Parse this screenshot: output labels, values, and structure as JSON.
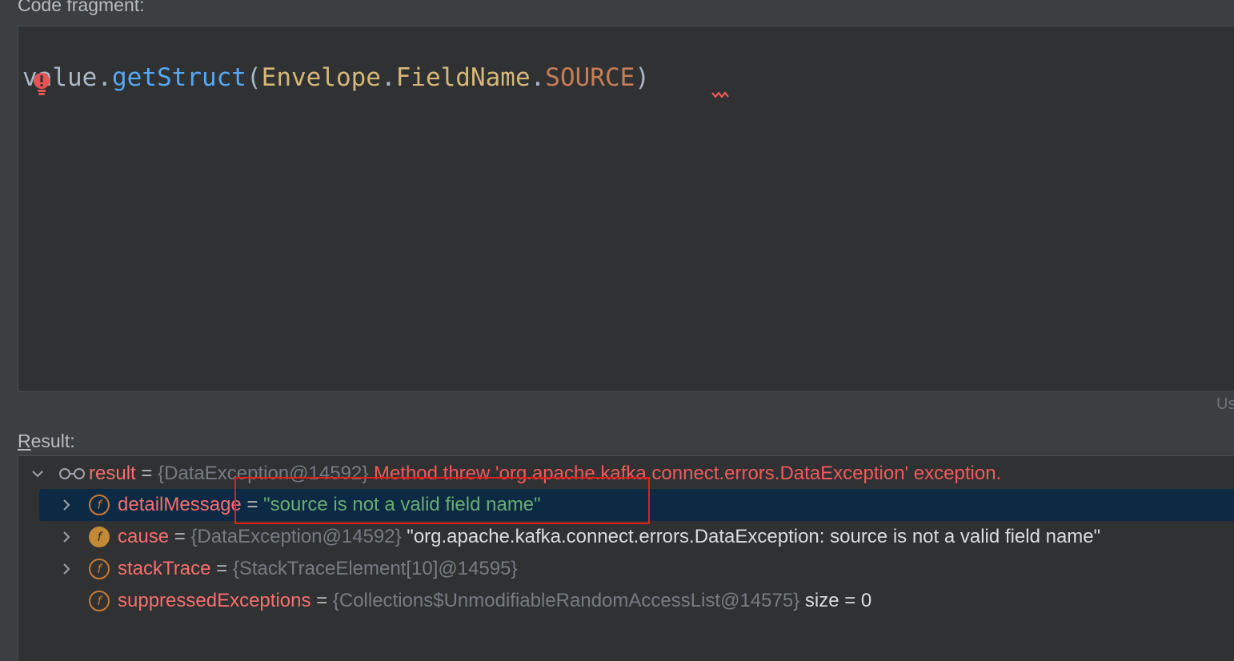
{
  "fragment_label": "Code fragment:",
  "editor": {
    "code": {
      "var": "value",
      "dot1": ".",
      "method": "getStruct",
      "paren_open": "(",
      "class1": "Envelope",
      "dot2": ".",
      "class2": "FieldName",
      "dot3": ".",
      "const": "SOURCE",
      "paren_close": ")"
    },
    "hint_right": "Us"
  },
  "result_label": {
    "mnemonic": "R",
    "rest": "esult:"
  },
  "tree": {
    "root": {
      "name": "result",
      "eq": " = ",
      "type": "{DataException@14592}",
      "message": " Method threw 'org.apache.kafka.connect.errors.DataException' exception."
    },
    "children": [
      {
        "name": "detailMessage",
        "eq": " = ",
        "value": "\"source is not a valid field name\""
      },
      {
        "name": "cause",
        "eq": " = ",
        "type": "{DataException@14592}",
        "value": " \"org.apache.kafka.connect.errors.DataException: source is not a valid field name\""
      },
      {
        "name": "stackTrace",
        "eq": " = ",
        "type": "{StackTraceElement[10]@14595}"
      },
      {
        "name": "suppressedExceptions",
        "eq": " = ",
        "type": "{Collections$UnmodifiableRandomAccessList@14575}",
        "value": "  size = 0"
      }
    ]
  },
  "icons": {
    "field": "f",
    "expand": "chevron-right-icon",
    "collapse": "chevron-down-icon",
    "watch": "glasses-icon",
    "error": "error-bulb-icon"
  },
  "colors": {
    "highlight_box": "#e0201c",
    "selection": "#0c2a43"
  }
}
